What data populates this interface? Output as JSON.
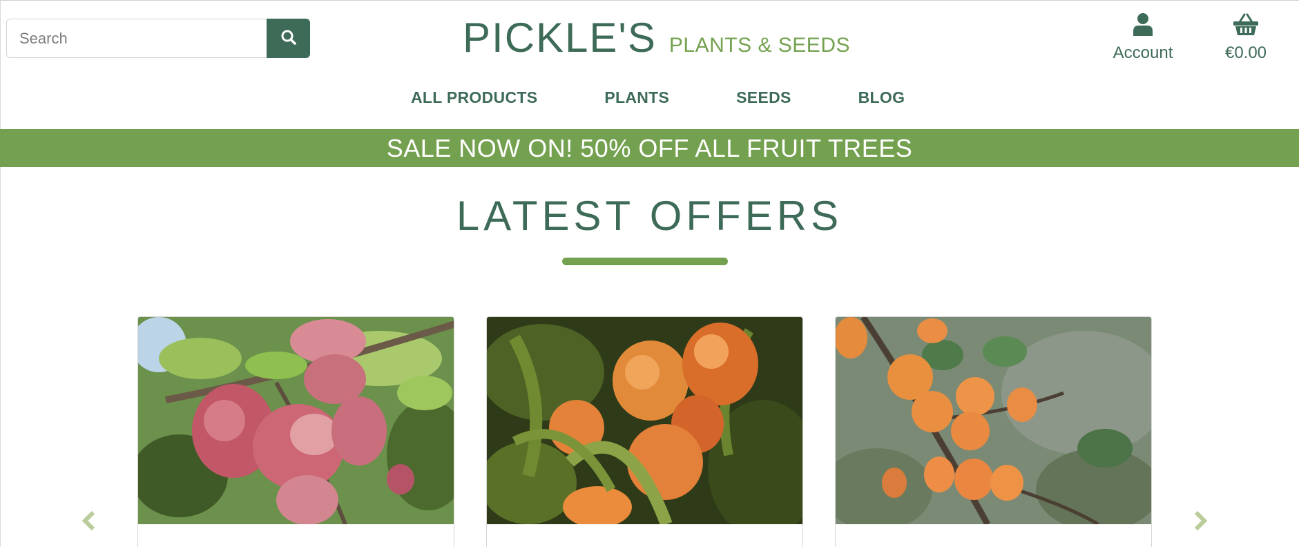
{
  "header": {
    "search": {
      "placeholder": "Search",
      "value": ""
    },
    "logo": {
      "main": "PICKLE'S",
      "sub": "PLANTS & SEEDS"
    },
    "account_label": "Account",
    "basket_total": "€0.00"
  },
  "nav": {
    "items": [
      "ALL PRODUCTS",
      "PLANTS",
      "SEEDS",
      "BLOG"
    ]
  },
  "banner": {
    "text": "SALE NOW ON! 50% OFF ALL FRUIT TREES"
  },
  "offers": {
    "title": "LATEST OFFERS",
    "cards": [
      {
        "image": "plum-tree-image"
      },
      {
        "image": "peach-tree-image"
      },
      {
        "image": "apricot-tree-image"
      }
    ]
  },
  "icons": {
    "search": "search-icon",
    "account": "user-icon",
    "basket": "basket-icon",
    "prev": "chevron-left-icon",
    "next": "chevron-right-icon"
  },
  "colors": {
    "brand_dark": "#3d6b57",
    "brand_green": "#74a14f",
    "arrow": "#b9cc9a"
  }
}
